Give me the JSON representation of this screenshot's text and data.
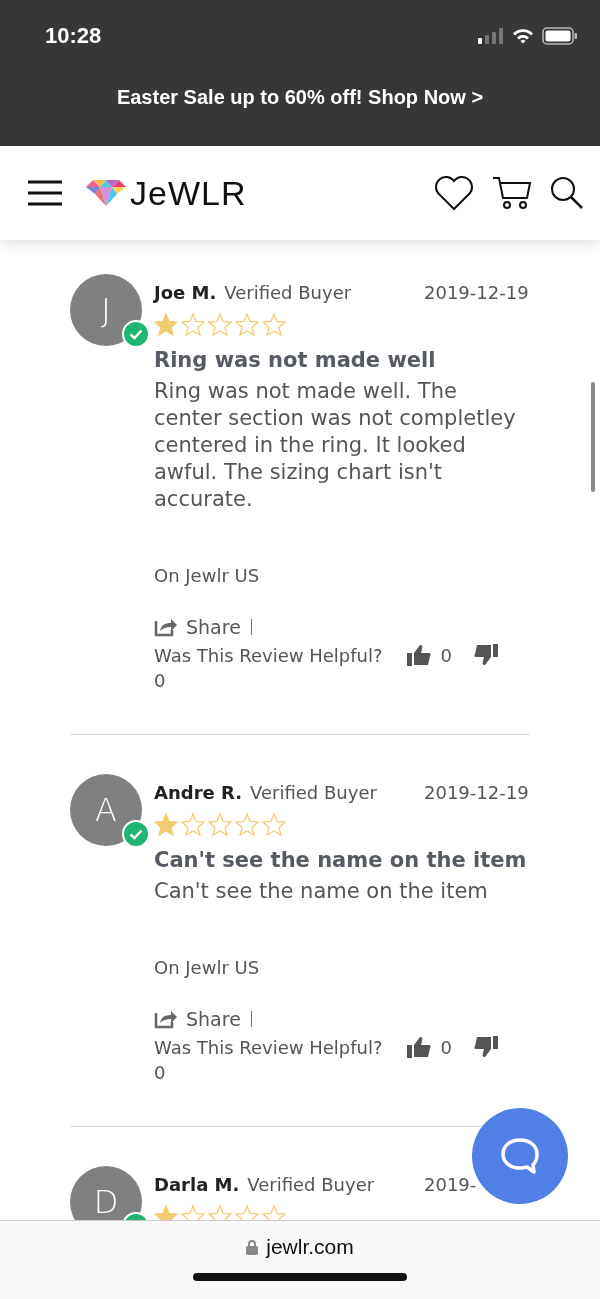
{
  "status_bar": {
    "time": "10:28"
  },
  "promo_banner": {
    "text": "Easter Sale up to 60% off! Shop Now >"
  },
  "header": {
    "logo": "JeWLR"
  },
  "reviews": [
    {
      "initial": "J",
      "name": "Joe M.",
      "badge": "Verified Buyer",
      "date": "2019-12-19",
      "verified": true,
      "stars": 1,
      "title": "Ring was not made well",
      "body": "Ring was not made well. The center section was not completley centered in the ring. It looked awful. The sizing chart isn't accurate.",
      "source": "On Jewlr US",
      "share": "Share",
      "helpful_prompt": "Was This Review Helpful?",
      "up_count": "0",
      "down_count": "0"
    },
    {
      "initial": "A",
      "name": "Andre R.",
      "badge": "Verified Buyer",
      "date": "2019-12-19",
      "verified": true,
      "stars": 1,
      "title": "Can't see the name on the item",
      "body": "Can't see the name on the item",
      "source": "On Jewlr US",
      "share": "Share",
      "helpful_prompt": "Was This Review Helpful?",
      "up_count": "0",
      "down_count": "0"
    },
    {
      "initial": "D",
      "name": "Darla M.",
      "badge": "Verified Buyer",
      "date": "2019-",
      "verified": true,
      "stars": 1
    }
  ],
  "browser_bar": {
    "url": "jewlr.com"
  }
}
